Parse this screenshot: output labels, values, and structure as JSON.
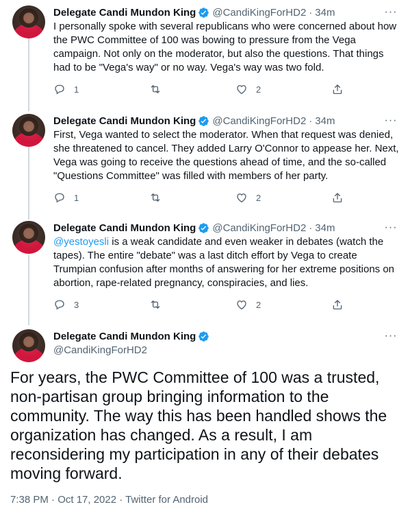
{
  "author": {
    "name": "Delegate Candi Mundon King",
    "handle": "@CandiKingForHD2",
    "time": "34m",
    "separator": "·"
  },
  "icons": {
    "verified": "verified-badge-icon",
    "more": "more-options-icon",
    "reply": "reply-icon",
    "retweet": "retweet-icon",
    "like": "like-icon",
    "share": "share-icon"
  },
  "colors": {
    "accent": "#1d9bf0",
    "muted": "#536471",
    "text": "#0f1419",
    "line": "#cfd9de"
  },
  "tweets": [
    {
      "text": "I personally spoke with several republicans who were concerned about how the PWC Committee of 100 was bowing to pressure from the Vega campaign. Not only on the moderator, but also the questions. That things had to be \"Vega's way\" or no way. Vega's way was two fold.",
      "replies": "1",
      "retweets": "",
      "likes": "2"
    },
    {
      "text": "First, Vega wanted to select the moderator. When that request was denied, she threatened to cancel. They added Larry O'Connor to appease her. Next, Vega was going to receive the questions ahead of time, and the so-called \"Questions Committee\" was filled with members of her party.",
      "replies": "1",
      "retweets": "",
      "likes": "2"
    },
    {
      "mention": "@yestoyesli",
      "text": " is a weak candidate and even weaker in debates (watch the tapes). The entire \"debate\" was a last ditch effort by Vega to create Trumpian confusion after months of answering for her extreme positions on abortion, rape-related pregnancy, conspiracies, and lies.",
      "replies": "3",
      "retweets": "",
      "likes": "2"
    }
  ],
  "focused": {
    "text": "For years, the PWC Committee of 100 was a trusted, non-partisan group bringing information to the community. The way this has been handled shows the organization has changed. As a result, I am reconsidering my participation in any of their debates moving forward.",
    "meta": "7:38 PM · Oct 17, 2022 · Twitter for Android"
  },
  "more_glyph": "···"
}
